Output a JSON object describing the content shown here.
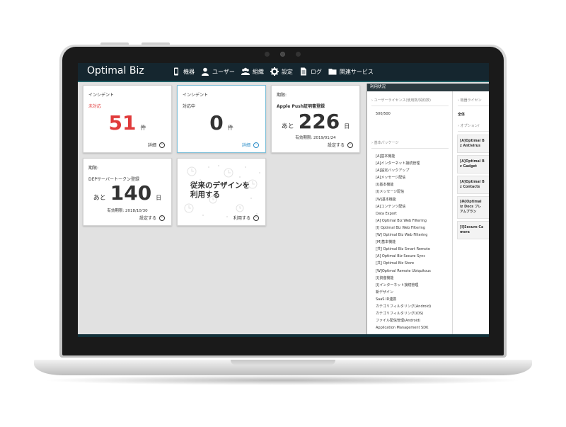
{
  "app": {
    "brand": "Optimal Biz"
  },
  "nav": [
    {
      "label": "機器",
      "icon": "phone-icon"
    },
    {
      "label": "ユーザー",
      "icon": "user-icon"
    },
    {
      "label": "組織",
      "icon": "group-icon"
    },
    {
      "label": "設定",
      "icon": "gear-icon"
    },
    {
      "label": "ログ",
      "icon": "document-icon"
    },
    {
      "label": "関連サービス",
      "icon": "folder-icon"
    }
  ],
  "cards": {
    "incident_unhandled": {
      "title": "インシデント",
      "status": "未対応",
      "count": "51",
      "unit": "件",
      "link": "詳細"
    },
    "incident_in_progress": {
      "title": "インシデント",
      "status": "対応中",
      "count": "0",
      "unit": "件",
      "link": "詳細"
    },
    "apple_push": {
      "title": "期限:",
      "subtitle": "Apple Push証明書登録",
      "prefix": "あと",
      "count": "226",
      "unit": "日",
      "expiry": "有効期限: 2019/01/24",
      "link": "設定する"
    },
    "dep_token": {
      "title": "期限:",
      "subtitle": "DEPサーバートークン登録",
      "prefix": "あと",
      "count": "140",
      "unit": "日",
      "expiry": "有効期限: 2018/10/30",
      "link": "設定する"
    },
    "legacy_design": {
      "text_line1": "従来のデザインを",
      "text_line2": "利用する",
      "link": "利用する"
    }
  },
  "usage_panel": {
    "header": "利用状況",
    "user_license_label": "ユーザーライセンス(使用数/契約数)",
    "user_license_value": "500/500",
    "basic_package_label": "基本パッケージ",
    "packages": [
      "[A]基本機能",
      "[A]インターネット接続管理",
      "[A]設定バックアップ",
      "[A]メッセージ配信",
      "[I]基本機能",
      "[I]メッセージ配信",
      "[W]基本機能",
      "[A]コンテンツ配信",
      "Data Export",
      "[A] Optimal Biz Web Filtering",
      "[I] Optimal Biz Web Filtering",
      "[W] Optimal Biz Web Filtering",
      "[M]基本機能",
      "[共] Optimal Biz Smart Remote",
      "[A] Optimal Biz Secure Sync",
      "[共] Optimal Biz Store",
      "[W]Optimal Remote Ubiquitous",
      "[I]資産機能",
      "[I]インターネット接続管理",
      "新デザイン",
      "SaaS ID連携",
      "カテゴリフィルタリング(Android)",
      "カテゴリフィルタリング(iOS)",
      "ファイル配信管理(Android)",
      "Application Management SDK"
    ],
    "device_license_label": "機器ライセン",
    "all_label": "全体",
    "option_label": "オプション/",
    "options": [
      {
        "line1": "[A]Optimal B",
        "line2": "z Antivirus"
      },
      {
        "line1": "[A]Optimal B",
        "line2": "z Gadget"
      },
      {
        "line1": "[A]Optimal B",
        "line2": "z Contacts"
      },
      {
        "line1": "[共]Optimal",
        "line2": "iz Docs プレ",
        "line3": "アムプラン"
      },
      {
        "line1": "[I]Secure Ca",
        "line2": "mera"
      }
    ]
  },
  "colors": {
    "topbar": "#15262f",
    "accent": "#1e5e63",
    "alert_red": "#e03a3a",
    "link_blue": "#2f8fc9"
  }
}
